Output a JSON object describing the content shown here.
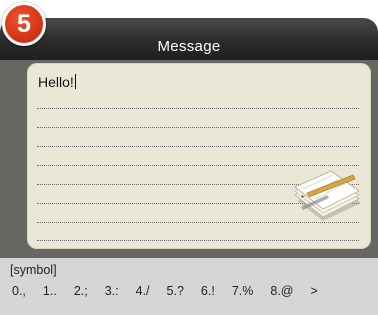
{
  "step_badge": "5",
  "header": {
    "title": "Message"
  },
  "message": {
    "text": "Hello!"
  },
  "symbol_bar": {
    "label": "[symbol]",
    "keys": [
      "0.,",
      "1..",
      "2.;",
      "3.:",
      "4./",
      "5.?",
      "6.!",
      "7.%",
      "8.@",
      ">"
    ]
  },
  "icons": {
    "note": "notepad-pencil-icon"
  },
  "colors": {
    "badge": "#d73515",
    "titlebar": "#2c2c2c",
    "note_bg": "#ebe7d6",
    "content_bg": "#666761"
  }
}
